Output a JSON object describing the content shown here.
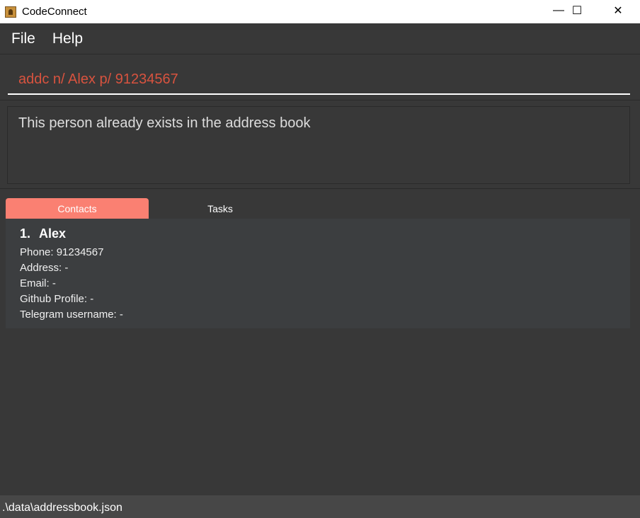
{
  "window": {
    "title": "CodeConnect",
    "minimize": "—",
    "maximize": "☐",
    "close": "✕"
  },
  "menu": {
    "file": "File",
    "help": "Help"
  },
  "command": {
    "value": "addc n/ Alex p/ 91234567"
  },
  "result": {
    "text": "This person already exists in the address book"
  },
  "tabs": [
    {
      "label": "Contacts"
    },
    {
      "label": "Tasks"
    }
  ],
  "contacts": [
    {
      "index": "1.",
      "name": "Alex",
      "phone": "Phone: 91234567",
      "address": "Address: -",
      "email": "Email: -",
      "github": "Github Profile: -",
      "telegram": "Telegram username: -"
    }
  ],
  "status": {
    "path": ".\\data\\addressbook.json"
  }
}
